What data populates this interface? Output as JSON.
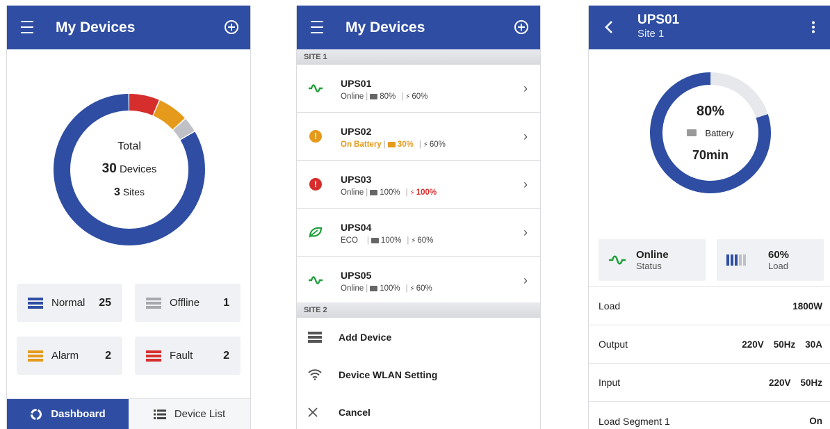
{
  "colors": {
    "primary": "#2f4ea3",
    "normal": "#2f4ea3",
    "offline": "#a6a8ad",
    "alarm": "#e59a1c",
    "fault": "#d62d2d",
    "online_green": "#1e9e3a",
    "gauge_track": "#e6e8ec"
  },
  "dashboard": {
    "title": "My Devices",
    "total_label": "Total",
    "devices_count": "30",
    "devices_label": "Devices",
    "sites_count": "3",
    "sites_label": "Sites",
    "chart_data": {
      "type": "donut",
      "series": [
        {
          "name": "Normal",
          "value": 25,
          "color": "#2f4ea3"
        },
        {
          "name": "Fault",
          "value": 2,
          "color": "#d62d2d"
        },
        {
          "name": "Alarm",
          "value": 2,
          "color": "#e59a1c"
        },
        {
          "name": "Offline",
          "value": 1,
          "color": "#bfc1c6"
        }
      ]
    },
    "stats": [
      {
        "label": "Normal",
        "count": "25"
      },
      {
        "label": "Offline",
        "count": "1"
      },
      {
        "label": "Alarm",
        "count": "2"
      },
      {
        "label": "Fault",
        "count": "2"
      }
    ],
    "tabs": {
      "dashboard": "Dashboard",
      "device_list": "Device List"
    }
  },
  "device_list": {
    "title": "My Devices",
    "site1": "SITE 1",
    "site2": "SITE 2",
    "devices": [
      {
        "name": "UPS01",
        "status": "Online",
        "battery": "80%",
        "load": "60%"
      },
      {
        "name": "UPS02",
        "status": "On Battery",
        "battery": "30%",
        "load": "60%"
      },
      {
        "name": "UPS03",
        "status": "Online",
        "battery": "100%",
        "load": "100%"
      },
      {
        "name": "UPS04",
        "status": "ECO",
        "battery": "100%",
        "load": "60%"
      },
      {
        "name": "UPS05",
        "status": "Online",
        "battery": "100%",
        "load": "60%"
      }
    ],
    "actions": {
      "add": "Add Device",
      "wlan": "Device WLAN Setting",
      "cancel": "Cancel"
    }
  },
  "detail": {
    "title": "UPS01",
    "subtitle": "Site 1",
    "battery_percent": "80%",
    "battery_value": 0.8,
    "battery_label": "Battery",
    "runtime": "70min",
    "status_value": "Online",
    "status_label": "Status",
    "load_value": "60%",
    "load_label": "Load",
    "rows": [
      {
        "label": "Load",
        "values": [
          "1800W"
        ]
      },
      {
        "label": "Output",
        "values": [
          "220V",
          "50Hz",
          "30A"
        ]
      },
      {
        "label": "Input",
        "values": [
          "220V",
          "50Hz"
        ]
      },
      {
        "label": "Load Segment 1",
        "values": [
          "On"
        ]
      }
    ]
  }
}
